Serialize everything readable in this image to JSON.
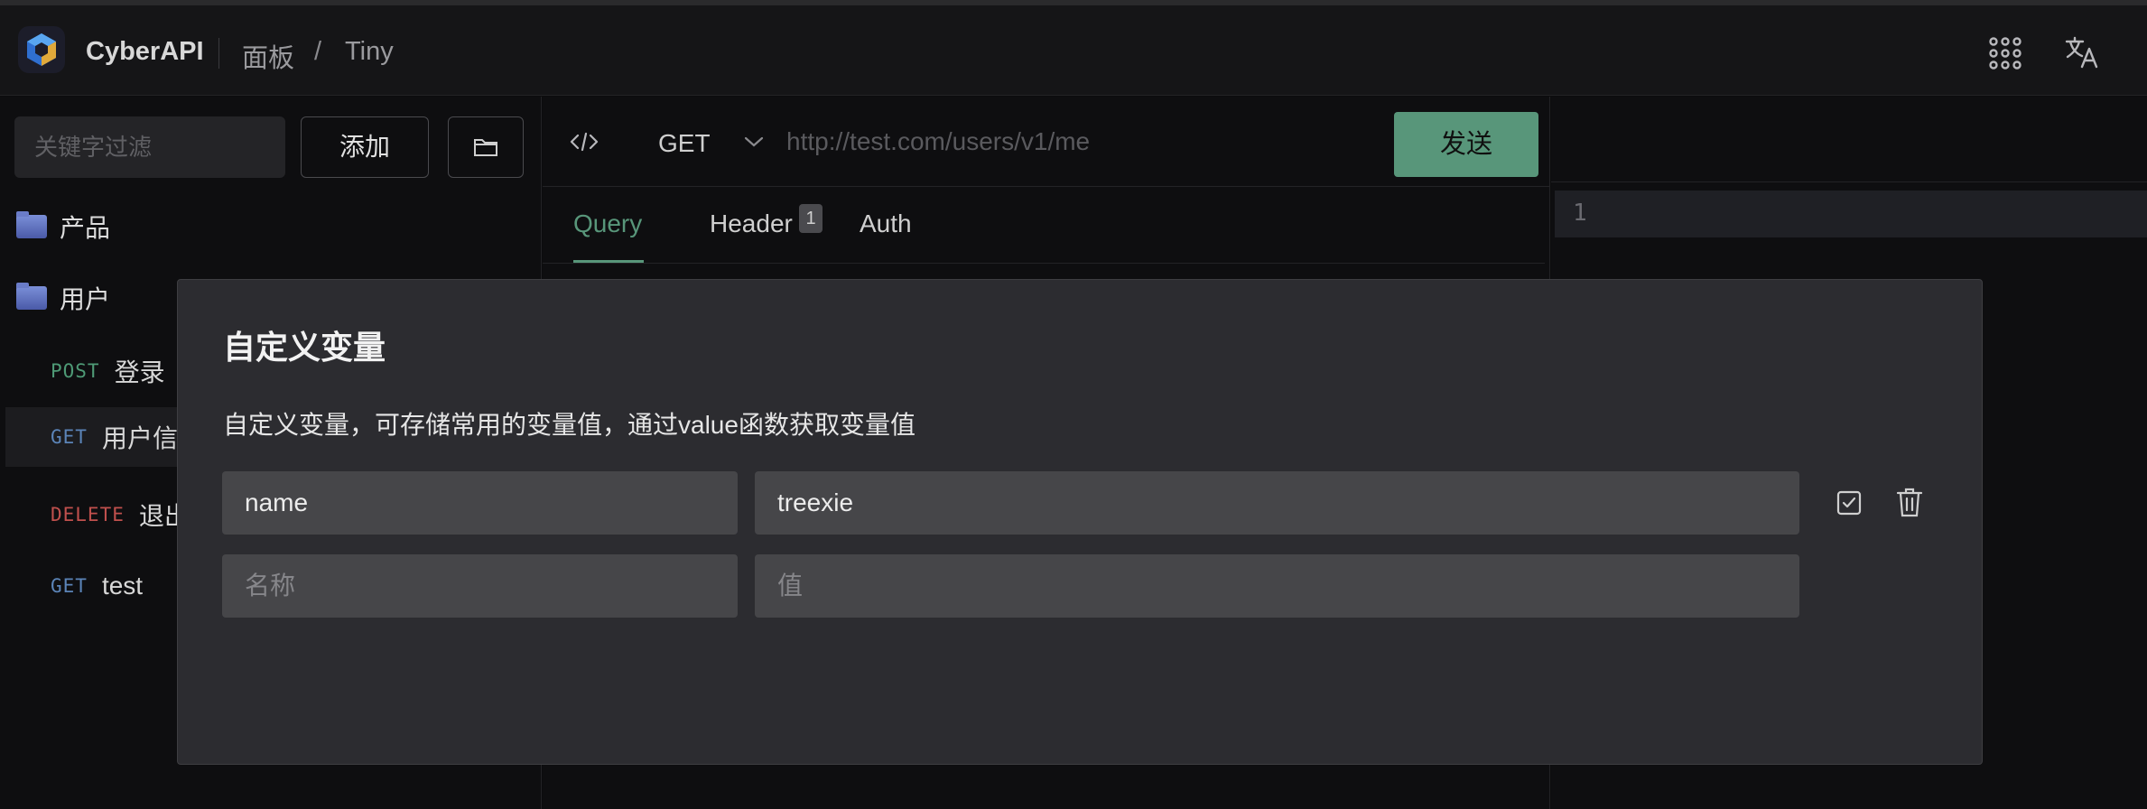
{
  "header": {
    "app_name": "CyberAPI",
    "breadcrumb": [
      "面板",
      "/",
      "Tiny"
    ],
    "icons": [
      "apps-grid-icon",
      "translate-icon"
    ]
  },
  "sidebar": {
    "filter_placeholder": "关键字过滤",
    "add_label": "添加",
    "folders": [
      {
        "label": "产品"
      },
      {
        "label": "用户"
      }
    ],
    "requests": [
      {
        "method": "POST",
        "name": "登录"
      },
      {
        "method": "GET",
        "name": "用户信"
      },
      {
        "method": "DELETE",
        "name": "退出"
      },
      {
        "method": "GET",
        "name": "test"
      }
    ]
  },
  "request": {
    "method": "GET",
    "url_placeholder": "http://test.com/users/v1/me",
    "send_label": "发送",
    "tabs": [
      {
        "label": "Query",
        "active": true
      },
      {
        "label": "Header",
        "badge": "1"
      },
      {
        "label": "Auth"
      }
    ]
  },
  "editor": {
    "line_number": "1"
  },
  "modal": {
    "title": "自定义变量",
    "description": "自定义变量，可存储常用的变量值，通过value函数获取变量值",
    "variables": [
      {
        "name": "name",
        "value": "treexie"
      }
    ],
    "new_row": {
      "name_placeholder": "名称",
      "value_placeholder": "值"
    }
  },
  "colors": {
    "accent": "#58967a",
    "post": "#4e9a76",
    "get": "#5b84b8",
    "delete": "#c0504d"
  }
}
